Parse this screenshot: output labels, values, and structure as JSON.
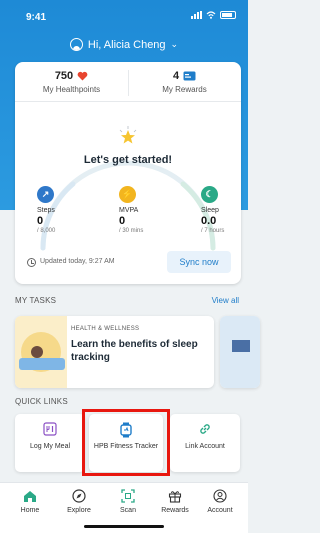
{
  "status_bar": {
    "time": "9:41"
  },
  "header": {
    "greeting": "Hi, Alicia Cheng"
  },
  "summary": {
    "healthpoints_value": "750",
    "healthpoints_label": "My Healthpoints",
    "rewards_value": "4",
    "rewards_label": "My Rewards",
    "headline": "Let's get started!",
    "stats": [
      {
        "label": "Steps",
        "value": "0",
        "target": "/ 8,000",
        "color": "#2f78c9"
      },
      {
        "label": "MVPA",
        "value": "0",
        "target": "/ 30 mins",
        "color": "#f2b51f"
      },
      {
        "label": "Sleep",
        "value": "0.0",
        "target": "/ 7 hours",
        "color": "#2aa987"
      }
    ],
    "synced_text": "Updated today, 9:27 AM",
    "sync_button": "Sync now"
  },
  "tasks": {
    "section_title": "MY TASKS",
    "view_all": "View all",
    "items": [
      {
        "category": "HEALTH & WELLNESS",
        "title": "Learn the benefits of sleep tracking"
      }
    ]
  },
  "quick_links": {
    "section_title": "QUICK LINKS",
    "items": [
      {
        "label": "Log My Meal",
        "icon": "meal-icon"
      },
      {
        "label": "HPB Fitness Tracker",
        "icon": "fitness-tracker-icon"
      },
      {
        "label": "Link Account",
        "icon": "link-icon"
      }
    ]
  },
  "bottom_nav": {
    "items": [
      {
        "label": "Home",
        "icon": "home-icon"
      },
      {
        "label": "Explore",
        "icon": "explore-icon"
      },
      {
        "label": "Scan",
        "icon": "scan-icon"
      },
      {
        "label": "Rewards",
        "icon": "gift-icon"
      },
      {
        "label": "Account",
        "icon": "account-icon"
      }
    ]
  },
  "colors": {
    "primary": "#1e8ad6",
    "accent_blue": "#1f7dc9",
    "heart": "#e8452f",
    "highlight": "#e8170f"
  }
}
